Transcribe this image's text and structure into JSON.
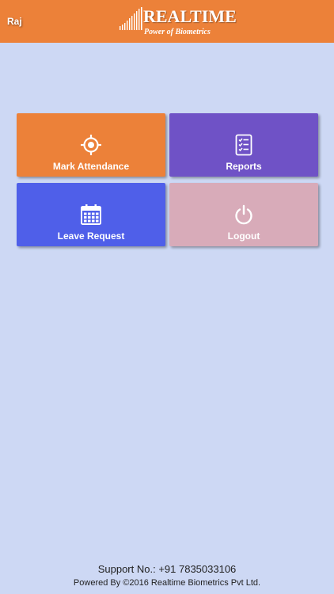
{
  "header": {
    "user_name": "Raj",
    "brand_name": "REALTIME",
    "brand_tagline": "Power of Biometrics",
    "background_color": "#ec8139"
  },
  "tiles": [
    {
      "label": "Mark Attendance",
      "icon": "target-icon",
      "color": "#ec8139"
    },
    {
      "label": "Reports",
      "icon": "checklist-icon",
      "color": "#6f52c6"
    },
    {
      "label": "Leave Request",
      "icon": "calendar-icon",
      "color": "#4f5fe9"
    },
    {
      "label": "Logout",
      "icon": "power-icon",
      "color": "#d8abb9"
    }
  ],
  "footer": {
    "support": "Support No.: +91 7835033106",
    "powered_by": "Powered By ©2016 Realtime Biometrics Pvt Ltd."
  }
}
